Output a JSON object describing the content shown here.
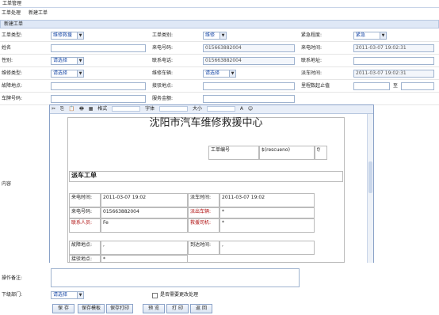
{
  "window_title": "工单管理",
  "tabs": [
    "工单处理",
    "新建工单"
  ],
  "section_title": "新建工单",
  "row1": {
    "ticket_type_label": "工单类型:",
    "ticket_type_value": "维修救援",
    "ticket_category_label": "工单类别:",
    "ticket_category_value": "维修",
    "priority_label": "紧急程度:",
    "priority_value": "紧急"
  },
  "row2": {
    "name_label": "姓名",
    "caller_label": "来电号码:",
    "caller_value": "015663882004",
    "time_label": "来电时间:",
    "time_value": "2011-03-07 19:02:31"
  },
  "row3": {
    "gender_label": "性别:",
    "gender_value": "请选择",
    "contact_label": "联系电话:",
    "contact_value": "015663882004",
    "address_label": "联系地址:"
  },
  "row4": {
    "repair_type_label": "维修类型:",
    "repair_type_value": "请选择",
    "vehicle_label": "维修车辆:",
    "vehicle_value": "请选择",
    "dispatch_time_label": "派车时间:",
    "dispatch_time_value": "2011-03-07 19:02:31"
  },
  "row5": {
    "fault_loc_label": "故障地点:",
    "pickup_loc_label": "接驳地点:",
    "distance_label": "里程数起止值",
    "to_label": "至"
  },
  "row6": {
    "plate_label": "车牌号码:",
    "amount_label": "服务金额:"
  },
  "editor": {
    "content_label": "内容",
    "toolbar_format": "格式",
    "toolbar_font": "字体",
    "toolbar_size": "大小"
  },
  "document": {
    "title": "沈阳市汽车维修救援中心",
    "ticket_no_label": "工单编号",
    "ticket_no_value": "$(rescueno)",
    "ticket_no_tail": "f/",
    "section": "派车工单",
    "call_time_label": "来电时间:",
    "call_time_value": "2011-03-07 19:02",
    "dispatch_time_label": "派车时间:",
    "dispatch_time_value": "2011-03-07 19:02",
    "caller_no_label": "来电号码:",
    "caller_no_value": "015663882004",
    "vehicle_label": "派出车辆:",
    "vehicle_value": "*",
    "contact_label": "联系人员:",
    "contact_value": "Fe",
    "mechanic_label": "救援司机:",
    "mechanic_value": "*",
    "fault_label": "故障地点:",
    "fault_value": ",",
    "arrival_label": "到达时间:",
    "arrival_value": ",",
    "pickup_label": "接驳地点:",
    "pickup_value": "*"
  },
  "notes_label": "操作备注:",
  "next_dept_label": "下级部门:",
  "next_dept_value": "请选择",
  "checkbox_label": "是否需要更改处理",
  "buttons": [
    "保 存",
    "保存模板",
    "保存打印",
    "预 览",
    "打 印",
    "返 回"
  ]
}
